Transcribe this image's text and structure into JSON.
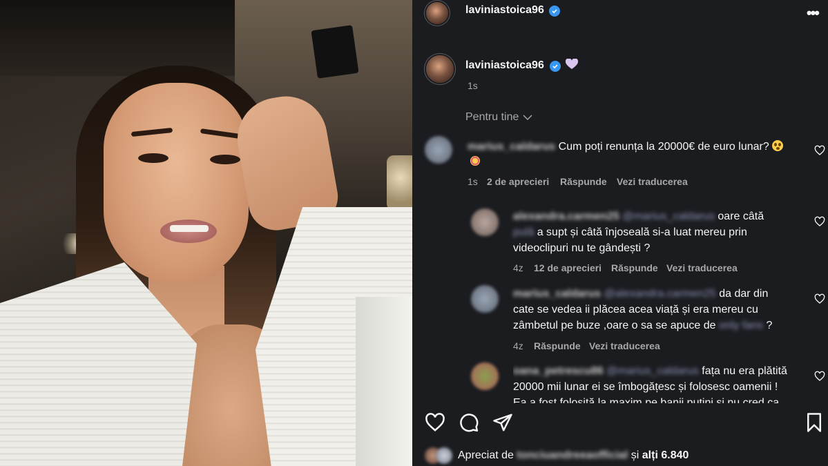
{
  "post": {
    "author": "laviniastoica96",
    "caption_emoji": "heart-emoji-lavender",
    "time": "1s",
    "verified_color": "#3897f0"
  },
  "comments_filter": "Pentru tine",
  "comments": [
    {
      "user": "marius_caldarus",
      "text_line1": "Cum poți renunța la 20000€ de euro lunar?",
      "time": "1s",
      "likes": "2 de aprecieri",
      "reply": "Răspunde",
      "translate": "Vezi traducerea"
    }
  ],
  "replies": [
    {
      "user": "alexandra.carmen25",
      "mention": "@marius_caldarus",
      "text_after_mention": "oare câtă",
      "line2_blurred": "pulă",
      "line2": "a supt și câtă înjoseală si-a luat mereu prin",
      "line3": "videoclipuri nu te gândești ?",
      "time": "4z",
      "likes": "12 de aprecieri",
      "reply": "Răspunde",
      "translate": "Vezi traducerea"
    },
    {
      "user": "marius_caldarus",
      "mention": "@alexandra.carmen25",
      "text_after_mention": "da dar din",
      "line2": "cate se vedea ii plăcea acea viață și era mereu cu",
      "line3": "zâmbetul pe buze ,oare o sa se apuce de",
      "line3_blurred": "only fans",
      "line3_end": "?",
      "time": "4z",
      "reply": "Răspunde",
      "translate": "Vezi traducerea"
    },
    {
      "user": "oana_petrescu86",
      "mention": "@marius_caldarus",
      "text_after_mention": "fața nu era plătită",
      "line2": "20000 mii lunar ei se îmbogățesc și folosesc oamenii !",
      "line3_partial": "Ea a fost folosită la maxim pe banii puțini și nu cred ca"
    }
  ],
  "likes": {
    "prefix": "Apreciat de",
    "user": "tonciuandreeaofficial",
    "suffix": "și",
    "others": "alți 6.840"
  },
  "colors": {
    "panel_bg": "#1b1c20",
    "text": "#f5f5f5",
    "muted": "#a8a8a8",
    "mention": "#8d94b8"
  }
}
